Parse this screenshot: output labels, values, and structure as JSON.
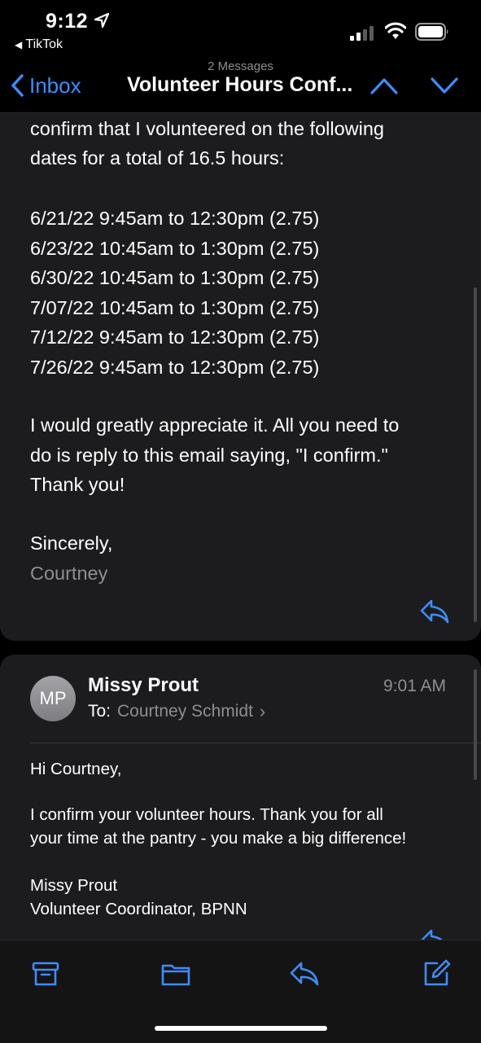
{
  "status_bar": {
    "time": "9:12",
    "back_app": "TikTok"
  },
  "nav": {
    "subtitle": "2 Messages",
    "back_label": "Inbox",
    "title": "Volunteer Hours Conf..."
  },
  "message1": {
    "intro_lines": [
      "confirm that I volunteered on the following",
      "dates for a total of 16.5 hours:"
    ],
    "dates": [
      "6/21/22 9:45am to 12:30pm (2.75)",
      "6/23/22 10:45am to 1:30pm (2.75)",
      "6/30/22 10:45am to 1:30pm (2.75)",
      "7/07/22 10:45am to 1:30pm (2.75)",
      "7/12/22 9:45am to 12:30pm (2.75)",
      "7/26/22 9:45am to 12:30pm (2.75)"
    ],
    "closing_lines": [
      "I would greatly appreciate it. All you need to",
      "do is reply to this email saying, \"I confirm.\"",
      "Thank you!"
    ],
    "sign_off": "Sincerely,",
    "signature": "Courtney"
  },
  "message2": {
    "avatar_initials": "MP",
    "sender": "Missy Prout",
    "time": "9:01 AM",
    "to_label": "To:",
    "to_name": "Courtney Schmidt",
    "greeting": "Hi Courtney,",
    "body_lines": [
      "I confirm your volunteer hours.  Thank you for all",
      "your time at the pantry - you make a big difference!"
    ],
    "signature_lines": [
      "Missy Prout",
      "Volunteer Coordinator, BPNN"
    ]
  },
  "toolbar": {
    "icons": [
      "archive-icon",
      "folder-icon",
      "reply-icon",
      "compose-icon"
    ]
  },
  "colors": {
    "accent": "#3d8dfb",
    "card_bg": "#1c1c1e",
    "secondary_text": "#8e8e93"
  }
}
